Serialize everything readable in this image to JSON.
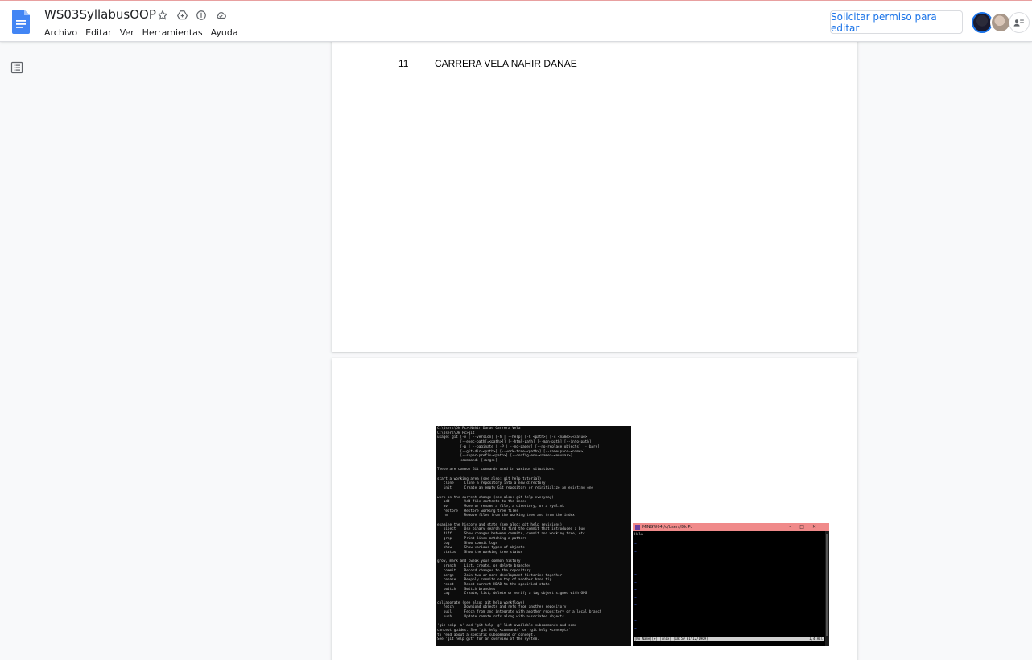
{
  "doc": {
    "title": "WS03SyllabusOOP",
    "title_icons": [
      "star-icon",
      "move-to-drive-icon",
      "info-icon",
      "cloud-status-icon"
    ],
    "menu": [
      "Archivo",
      "Editar",
      "Ver",
      "Herramientas",
      "Ayuda"
    ],
    "request_edit_label": "Solicitar permiso para editar",
    "brand_color": "#4285f4",
    "accent_color": "#1a73e8"
  },
  "content": {
    "row_number": "11",
    "row_name": "CARRERA VELA NAHIR DANAE"
  },
  "terminal1": {
    "lines": [
      "C:\\Users\\Dk Pc>:Nahir Danae Carrera Vela",
      "C:\\Users\\Dk Pc>git",
      "usage: git [-v | --version] [-h | --help] [-C <path>] [-c <name>=<value>]",
      "           [--exec-path[=<path>]] [--html-path] [--man-path] [--info-path]",
      "           [-p | --paginate | -P | --no-pager] [--no-replace-objects] [--bare]",
      "           [--git-dir=<path>] [--work-tree=<path>] [--namespace=<name>]",
      "           [--super-prefix=<path>] [--config-env=<name>=<envvar>]",
      "           <command> [<args>]",
      "",
      "These are common Git commands used in various situations:",
      "",
      "start a working area (see also: git help tutorial)",
      "   clone     Clone a repository into a new directory",
      "   init      Create an empty Git repository or reinitialize an existing one",
      "",
      "work on the current change (see also: git help everyday)",
      "   add       Add file contents to the index",
      "   mv        Move or rename a file, a directory, or a symlink",
      "   restore   Restore working tree files",
      "   rm        Remove files from the working tree and from the index",
      "",
      "examine the history and state (see also: git help revisions)",
      "   bisect    Use binary search to find the commit that introduced a bug",
      "   diff      Show changes between commits, commit and working tree, etc",
      "   grep      Print lines matching a pattern",
      "   log       Show commit logs",
      "   show      Show various types of objects",
      "   status    Show the working tree status",
      "",
      "grow, mark and tweak your common history",
      "   branch    List, create, or delete branches",
      "   commit    Record changes to the repository",
      "   merge     Join two or more development histories together",
      "   rebase    Reapply commits on top of another base tip",
      "   reset     Reset current HEAD to the specified state",
      "   switch    Switch branches",
      "   tag       Create, list, delete or verify a tag object signed with GPG",
      "",
      "collaborate (see also: git help workflows)",
      "   fetch     Download objects and refs from another repository",
      "   pull      Fetch from and integrate with another repository or a local branch",
      "   push      Update remote refs along with associated objects",
      "",
      "'git help -a' and 'git help -g' list available subcommands and some",
      "concept guides. See 'git help <command>' or 'git help <concept>'",
      "to read about a specific subcommand or concept.",
      "See 'git help git' for an overview of the system."
    ]
  },
  "terminal2": {
    "window_title": "MINGW64:/c/Users/Dk Pc",
    "first_line": "Hola",
    "status_left": "[No Name][+]  [unix]  (18:59 31/12/1969)",
    "status_right": "1,4 All"
  }
}
